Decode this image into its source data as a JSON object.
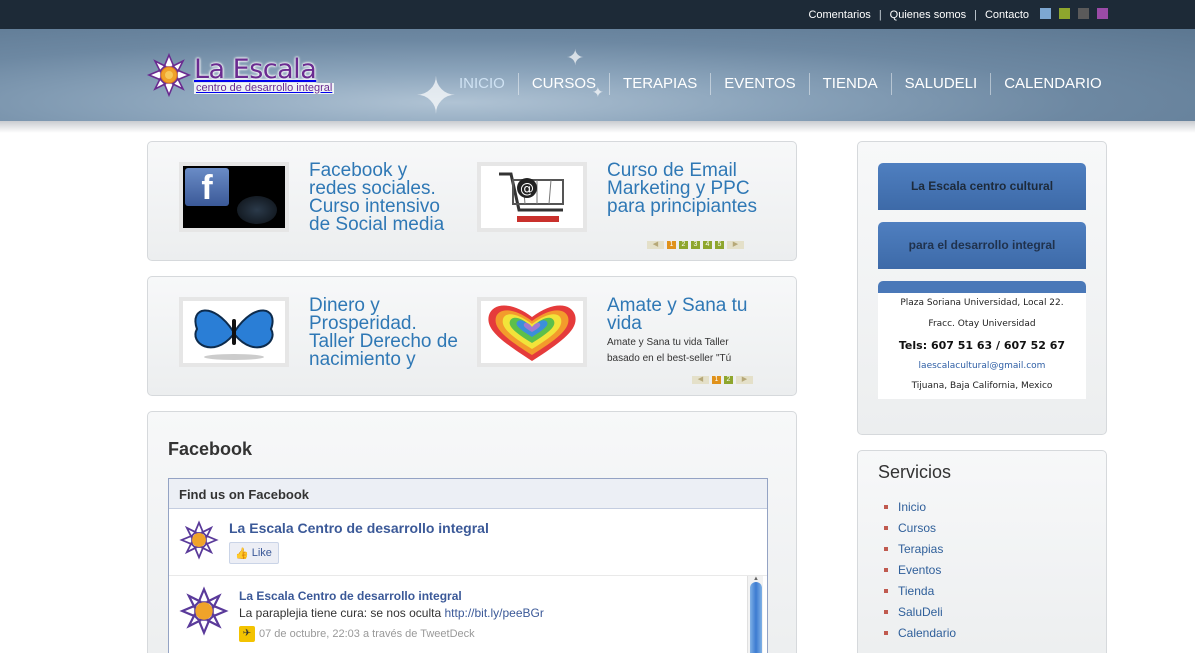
{
  "top_links": [
    "Comentarios",
    "Quienes somos",
    "Contacto"
  ],
  "swatch_colors": [
    "#7da7d1",
    "#8ea62d",
    "#5a5a5a",
    "#9b4ba7"
  ],
  "logo": {
    "title": "La Escala",
    "subtitle": "centro de desarrollo integral"
  },
  "nav": [
    {
      "label": "INICIO",
      "active": true
    },
    {
      "label": "CURSOS"
    },
    {
      "label": "TERAPIAS"
    },
    {
      "label": "EVENTOS"
    },
    {
      "label": "TIENDA"
    },
    {
      "label": "SALUDELI"
    },
    {
      "label": "CALENDARIO"
    }
  ],
  "slider1": {
    "items": [
      {
        "title": "Facebook y redes sociales. Curso intensivo de Social media",
        "image": "facebook-image"
      },
      {
        "title": "Curso de Email Marketing y PPC para principiantes",
        "image": "email-cart-image"
      }
    ],
    "pages": [
      "1",
      "2",
      "3",
      "4",
      "5"
    ],
    "current": "1"
  },
  "slider2": {
    "items": [
      {
        "title": "Dinero y Prosperidad. Taller Derecho de nacimiento y",
        "image": "butterfly-image"
      },
      {
        "title": "Amate y Sana tu vida",
        "desc": "Amate y Sana tu vida Taller basado en el best-seller \"Tú",
        "image": "heart-image"
      }
    ],
    "pages": [
      "1",
      "2"
    ],
    "current": "1"
  },
  "facebook": {
    "section_title": "Facebook",
    "box_header": "Find us on Facebook",
    "page_name": "La Escala Centro de desarrollo integral",
    "like_label": "Like",
    "post": {
      "author": "La Escala Centro de desarrollo integral",
      "text": "La paraplejia tiene cura: se nos oculta",
      "link": "http://bit.ly/peeBGr",
      "meta": "07 de octubre, 22:03 a través de TweetDeck"
    }
  },
  "info": {
    "button1": "La Escala centro cultural",
    "button2": "para el desarrollo integral",
    "address1": "Plaza Soriana Universidad, Local 22.",
    "address2": "Fracc. Otay Universidad",
    "tel": "Tels: 607 51 63 / 607 52 67",
    "email": "laescalacultural@gmail.com",
    "city": "Tijuana, Baja California, Mexico"
  },
  "services": {
    "title": "Servicios",
    "items": [
      "Inicio",
      "Cursos",
      "Terapias",
      "Eventos",
      "Tienda",
      "SaluDeli",
      "Calendario"
    ]
  }
}
